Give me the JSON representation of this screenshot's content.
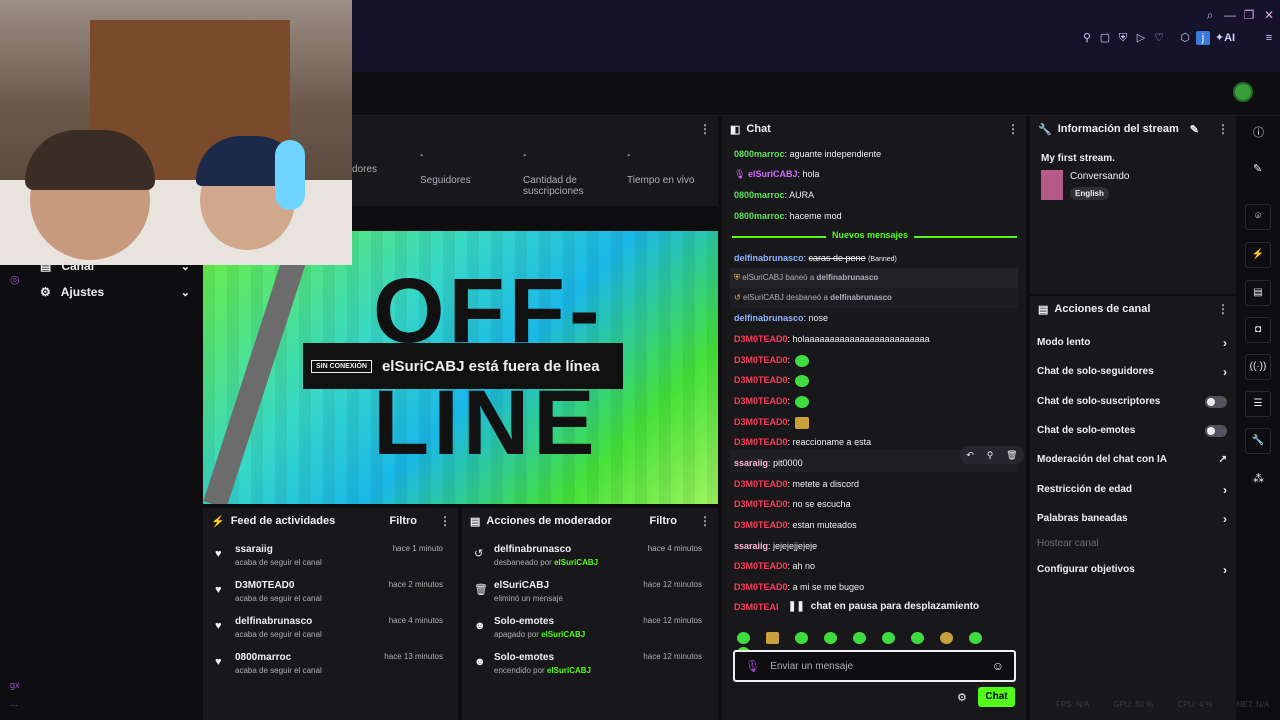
{
  "window": {
    "toolbar_icons": [
      "pin-icon",
      "square-icon",
      "shield-icon",
      "play-icon",
      "heart-icon",
      "puzzle-icon",
      "j-icon",
      "ai-icon",
      "menu-icon"
    ],
    "ai_label": "AI",
    "j_label": "j"
  },
  "left_nav": {
    "canal_label": "Canal",
    "ajustes_label": "Ajustes",
    "bottom_label": "gx",
    "more_label": "..."
  },
  "stats": [
    {
      "value": "",
      "label": "dores"
    },
    {
      "value": "-",
      "label": "Seguidores"
    },
    {
      "value": "-",
      "label": "Cantidad de suscripciones"
    },
    {
      "value": "-",
      "label": "Tiempo en vivo"
    }
  ],
  "offline": {
    "badge": "SIN CONEXIÓN",
    "title": "elSuriCABJ está fuera de línea",
    "bg_text_top": "OFF-",
    "bg_text_bottom": "LINE"
  },
  "activity_feed": {
    "title": "Feed de actividades",
    "filter": "Filtro",
    "items": [
      {
        "name": "ssaraiig",
        "sub": "acaba de seguir el canal",
        "time": "hace 1 minuto"
      },
      {
        "name": "D3M0TEAD0",
        "sub": "acaba de seguir el canal",
        "time": "hace 2 minutos"
      },
      {
        "name": "delfinabrunasco",
        "sub": "acaba de seguir el canal",
        "time": "hace 4 minutos"
      },
      {
        "name": "0800marroc",
        "sub": "acaba de seguir el canal",
        "time": "hace 13 minutos"
      }
    ]
  },
  "mod_actions": {
    "title": "Acciones de moderador",
    "filter": "Filtro",
    "items": [
      {
        "name": "delfinabrunasco",
        "sub": "desbaneado por",
        "by": "elSuriCABJ",
        "time": "hace 4 minutos"
      },
      {
        "name": "elSuriCABJ",
        "sub": "eliminó un mensaje",
        "by": "",
        "time": "hace 12 minutos"
      },
      {
        "name": "Solo-emotes",
        "sub": "apagado por",
        "by": "elSuriCABJ",
        "time": "hace 12 minutos"
      },
      {
        "name": "Solo-emotes",
        "sub": "encendido por",
        "by": "elSuriCABJ",
        "time": "hace 12 minutos"
      }
    ]
  },
  "chat": {
    "title": "Chat",
    "new_messages": "Nuevos mensajes",
    "paused": "chat en pausa para desplazamiento",
    "paused_prefix": "D3M0TEAI",
    "input_placeholder": "Enviar un mensaje",
    "send_label": "Chat",
    "messages_top": [
      {
        "user": "0800marroc",
        "text": "aguante independiente",
        "color": "#5fe05f"
      },
      {
        "user": "elSuriCABJ",
        "text": "hola",
        "color": "#d06cff"
      },
      {
        "user": "0800marroc",
        "text": "AURA",
        "color": "#5fe05f"
      },
      {
        "user": "0800marroc",
        "text": "haceme mod",
        "color": "#5fe05f"
      }
    ],
    "msg_delf1_user": "delfinabrunasco",
    "msg_delf1_text": "caras de pene",
    "msg_delf1_tag": "(Banned)",
    "ban_line": {
      "actor": "elSuriCABJ",
      "verb": "baneó a",
      "target": "delfinabrunasco"
    },
    "unban_line": {
      "actor": "elSuriCABJ",
      "verb": "desbaneó a",
      "target": "delfinabrunasco"
    },
    "msg_delf2_user": "delfinabrunasco",
    "msg_delf2_text": "nose",
    "messages_bottom": [
      {
        "user": "D3M0TEAD0",
        "text": "holaaaaaaaaaaaaaaaaaaaaaaaaa",
        "color": "#ff3a5a"
      },
      {
        "user": "D3M0TEAD0",
        "text": "",
        "color": "#ff3a5a"
      },
      {
        "user": "D3M0TEAD0",
        "text": "",
        "color": "#ff3a5a"
      },
      {
        "user": "D3M0TEAD0",
        "text": "",
        "color": "#ff3a5a"
      },
      {
        "user": "D3M0TEAD0",
        "text": "",
        "color": "#ff3a5a"
      },
      {
        "user": "D3M0TEAD0",
        "text": "reaccioname a esta",
        "color": "#ff3a5a"
      },
      {
        "user": "ssaraiig",
        "text": "pit0000",
        "color": "#ffb6d4"
      },
      {
        "user": "D3M0TEAD0",
        "text": "metete a discord",
        "color": "#ff3a5a"
      },
      {
        "user": "D3M0TEAD0",
        "text": "no se escucha",
        "color": "#ff3a5a"
      },
      {
        "user": "D3M0TEAD0",
        "text": "estan muteados",
        "color": "#ff3a5a"
      },
      {
        "user": "ssaraiig",
        "text": "jejejejjejeje",
        "color": "#ffb6d4"
      },
      {
        "user": "D3M0TEAD0",
        "text": "ah no",
        "color": "#ff3a5a"
      },
      {
        "user": "D3M0TEAD0",
        "text": "a mi se me bugeo",
        "color": "#ff3a5a"
      }
    ]
  },
  "stream_info": {
    "title": "Información del stream",
    "stream_title": "My first stream.",
    "category": "Conversando",
    "tag": "English"
  },
  "channel_actions": {
    "title": "Acciones de canal",
    "items": [
      {
        "label": "Modo lento",
        "control": "chevron"
      },
      {
        "label": "Chat de solo-seguidores",
        "control": "chevron"
      },
      {
        "label": "Chat de solo-suscriptores",
        "control": "toggle"
      },
      {
        "label": "Chat de solo-emotes",
        "control": "toggle"
      },
      {
        "label": "Moderación del chat con IA",
        "control": "external"
      },
      {
        "label": "Restricción de edad",
        "control": "chevron"
      },
      {
        "label": "Palabras baneadas",
        "control": "chevron"
      },
      {
        "label": "Hostear canal",
        "control": "disabled"
      },
      {
        "label": "Configurar objetivos",
        "control": "chevron"
      }
    ]
  },
  "status_bar": {
    "fps": "FPS: N/A",
    "gpu": "GPU: 80 %",
    "cpu": "CPU: 4 %",
    "net": "NET: N/A"
  },
  "colors": {
    "accent": "#53fc18",
    "panel": "#18181b",
    "bg": "#0e0e10"
  }
}
